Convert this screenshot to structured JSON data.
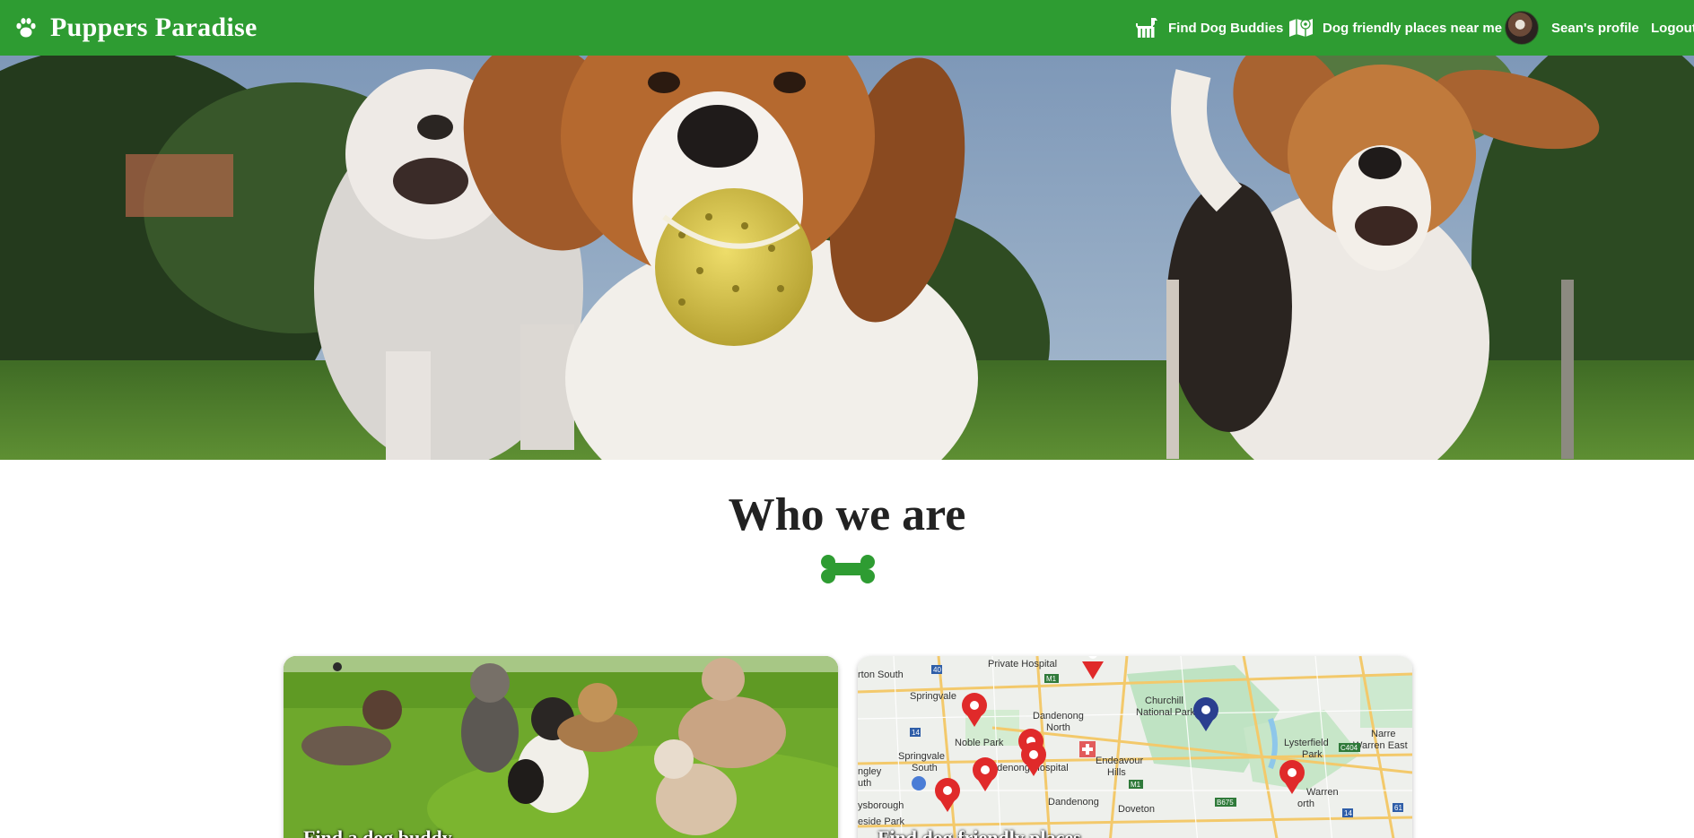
{
  "brand": {
    "title": "Puppers Paradise",
    "icon": "paw-icon"
  },
  "nav": {
    "find_buddies": "Find Dog Buddies",
    "places": "Dog friendly places near me",
    "profile": "Sean's profile",
    "logout": "Logout"
  },
  "colors": {
    "primary": "#2e9c32",
    "marker_red": "#e02a2a",
    "marker_blue": "#2a3f8f"
  },
  "section": {
    "title": "Who we are",
    "divider_icon": "bone-icon"
  },
  "cards": [
    {
      "caption": "Find a dog buddy"
    },
    {
      "caption": "Find dog friendly places"
    }
  ],
  "map_labels": {
    "private_hospital": "Private Hospital",
    "south": "rton South",
    "springvale": "Springvale",
    "dandenong_north_1": "Dandenong",
    "dandenong_north_2": "North",
    "churchill_1": "Churchill",
    "churchill_2": "National Park",
    "noble_park": "Noble Park",
    "springvale_south_1": "Springvale",
    "springvale_south_2": "South",
    "ngley": "ngley",
    "ngley2": "uth",
    "dandenong_hospital": "Dandenong Hospital",
    "endeavour_1": "Endeavour",
    "endeavour_2": "Hills",
    "lysterfield_1": "Lysterfield",
    "lysterfield_2": "Park",
    "narre_1": "Narre",
    "narre_2": "Warren East",
    "keysborough": "ysborough",
    "dandenong": "Dandenong",
    "doveton": "Doveton",
    "narre_warren_1": "Warren",
    "narre_warren_2": "orth",
    "eside_park": "eside Park",
    "road_m1": "M1",
    "road_40": "40",
    "road_14": "14",
    "road_c404": "C404",
    "road_b675": "B675",
    "road_m1b": "M1",
    "road_14b": "14",
    "road_61": "61"
  }
}
